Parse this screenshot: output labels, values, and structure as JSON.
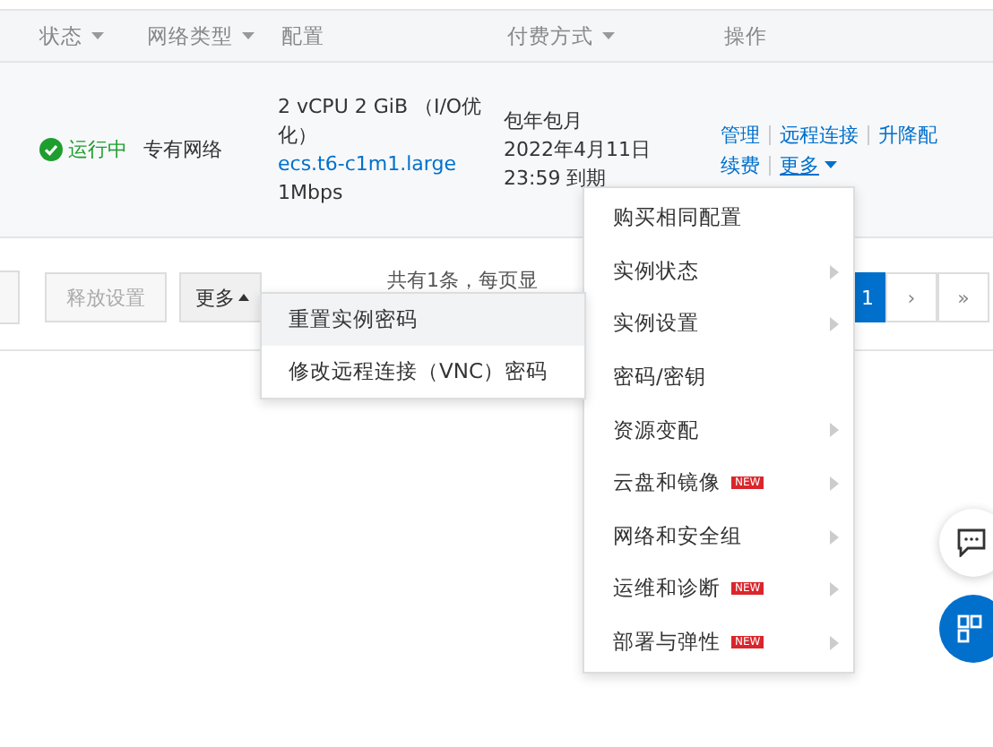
{
  "table": {
    "columns": [
      {
        "label": "状态",
        "sortable": true
      },
      {
        "label": "网络类型",
        "sortable": true
      },
      {
        "label": "配置",
        "sortable": false
      },
      {
        "label": "付费方式",
        "sortable": true
      },
      {
        "label": "操作",
        "sortable": false
      }
    ],
    "row": {
      "status": "运行中",
      "network": "专有网络",
      "config": "2 vCPU 2 GiB （I/O优化）",
      "instance_type": "ecs.t6-c1m1.large",
      "bandwidth": "1Mbps",
      "billing": "包年包月",
      "expiry": "2022年4月11日 23:59 到期",
      "actions": [
        [
          {
            "label": "管理",
            "expanded": false,
            "dropdown": false
          },
          {
            "label": "远程连接",
            "expanded": false,
            "dropdown": false
          },
          {
            "label": "升降配",
            "expanded": false,
            "dropdown": false
          }
        ],
        [
          {
            "label": "续费",
            "expanded": false,
            "dropdown": false
          },
          {
            "label": "更多",
            "expanded": true,
            "dropdown": true
          }
        ]
      ]
    }
  },
  "footer": {
    "buttons": [
      {
        "label": "释放设置",
        "disabled": true,
        "dropdown": false
      },
      {
        "label": "更多",
        "disabled": false,
        "expanded": true,
        "dropdown": true
      }
    ],
    "summary": "共有1条，每页显",
    "pages": [
      {
        "label": "1",
        "selected": true
      },
      {
        "label": "›",
        "selected": false
      },
      {
        "label": "»",
        "selected": false
      }
    ]
  },
  "more_menu": {
    "items": [
      {
        "label": "购买相同配置",
        "submenu": false
      },
      {
        "label": "实例状态",
        "submenu": true
      },
      {
        "label": "实例设置",
        "submenu": true
      },
      {
        "label": "密码/密钥",
        "submenu": false
      },
      {
        "label": "资源变配",
        "submenu": true
      },
      {
        "label": "云盘和镜像",
        "submenu": true,
        "badge": "NEW"
      },
      {
        "label": "网络和安全组",
        "submenu": true
      },
      {
        "label": "运维和诊断",
        "submenu": true,
        "badge": "NEW"
      },
      {
        "label": "部署与弹性",
        "submenu": true,
        "badge": "NEW"
      }
    ]
  },
  "submenu": {
    "items": [
      {
        "label": "重置实例密码",
        "selected": true
      },
      {
        "label": "修改远程连接（VNC）密码",
        "selected": false
      }
    ]
  }
}
